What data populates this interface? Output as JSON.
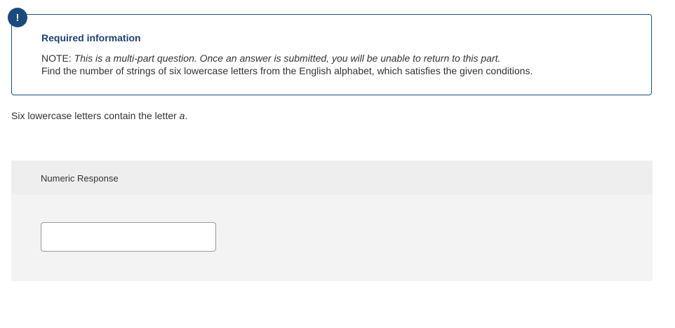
{
  "info": {
    "badge_icon": "exclamation-icon",
    "badge_glyph": "!",
    "title": "Required information",
    "note_prefix": "NOTE: ",
    "note_italic": "This is a multi-part question. Once an answer is submitted, you will be unable to return to this part.",
    "instruction": "Find the number of strings of six lowercase letters from the English alphabet, which satisfies the given conditions."
  },
  "question": {
    "text": "Six lowercase letters contain the letter ",
    "italic_letter": "a",
    "suffix": "."
  },
  "response": {
    "label": "Numeric Response",
    "value": ""
  },
  "colors": {
    "accent": "#1b4a7c",
    "border": "#1e4f80",
    "panel_bg": "#f3f3f3"
  }
}
